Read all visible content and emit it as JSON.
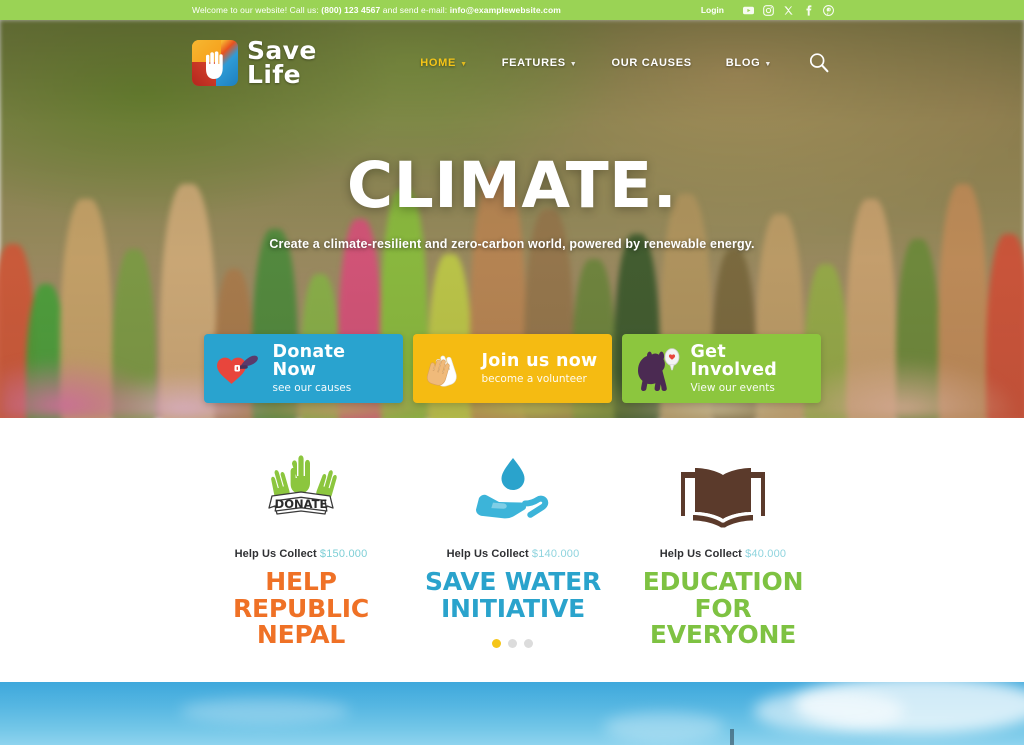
{
  "topbar": {
    "welcome_prefix": "Welcome to our website! Call us: ",
    "phone": "(800) 123 4567",
    "welcome_mid": " and send e-mail: ",
    "email": "info@examplewebsite.com",
    "login_label": "Login",
    "social": [
      {
        "name": "youtube-icon",
        "label": "YouTube"
      },
      {
        "name": "instagram-icon",
        "label": "Instagram"
      },
      {
        "name": "x-twitter-icon",
        "label": "X"
      },
      {
        "name": "facebook-icon",
        "label": "Facebook"
      },
      {
        "name": "pinterest-icon",
        "label": "Pinterest"
      }
    ],
    "bg_color": "#9ad355"
  },
  "header": {
    "logo_line1": "Save",
    "logo_line2": "Life",
    "nav": [
      {
        "label": "HOME",
        "has_dropdown": true,
        "active": true
      },
      {
        "label": "FEATURES",
        "has_dropdown": true,
        "active": false
      },
      {
        "label": "OUR CAUSES",
        "has_dropdown": false,
        "active": false
      },
      {
        "label": "BLOG",
        "has_dropdown": true,
        "active": false
      }
    ],
    "search_icon": "search-icon",
    "active_color": "#f5c518"
  },
  "hero": {
    "title": "CLIMATE.",
    "subtitle": "Create a climate-resilient and zero-carbon world, powered by renewable energy.",
    "ctas": [
      {
        "title": "Donate Now",
        "subtitle": "see our causes",
        "color": "#29a3cf",
        "icon": "heart-hand-icon"
      },
      {
        "title": "Join us now",
        "subtitle": "become a volunteer",
        "color": "#f5bb12",
        "icon": "clapping-hands-icon"
      },
      {
        "title": "Get Involved",
        "subtitle": "View our events",
        "color": "#8cc63e",
        "icon": "dog-icon"
      }
    ]
  },
  "causes": {
    "collect_label": "Help Us Collect",
    "items": [
      {
        "icon": "donate-hands-icon",
        "amount": "$150.000",
        "title_line1": "HELP REPUBLIC",
        "title_line2": "NEPAL",
        "color": "#ef7126",
        "amount_color": "#7ecfd6"
      },
      {
        "icon": "water-drop-hand-icon",
        "amount": "$140.000",
        "title_line1": "SAVE WATER",
        "title_line2": "INITIATIVE",
        "color": "#2aa3cc",
        "amount_color": "#8fd4de"
      },
      {
        "icon": "open-book-icon",
        "amount": "$40.000",
        "title_line1": "EDUCATION",
        "title_line2": "FOR EVERYONE",
        "color": "#7ec242",
        "amount_color": "#8fd4de"
      }
    ],
    "carousel_dots": [
      {
        "active": true
      },
      {
        "active": false
      },
      {
        "active": false
      }
    ]
  },
  "sky_section": {
    "name": "sky-banner"
  }
}
